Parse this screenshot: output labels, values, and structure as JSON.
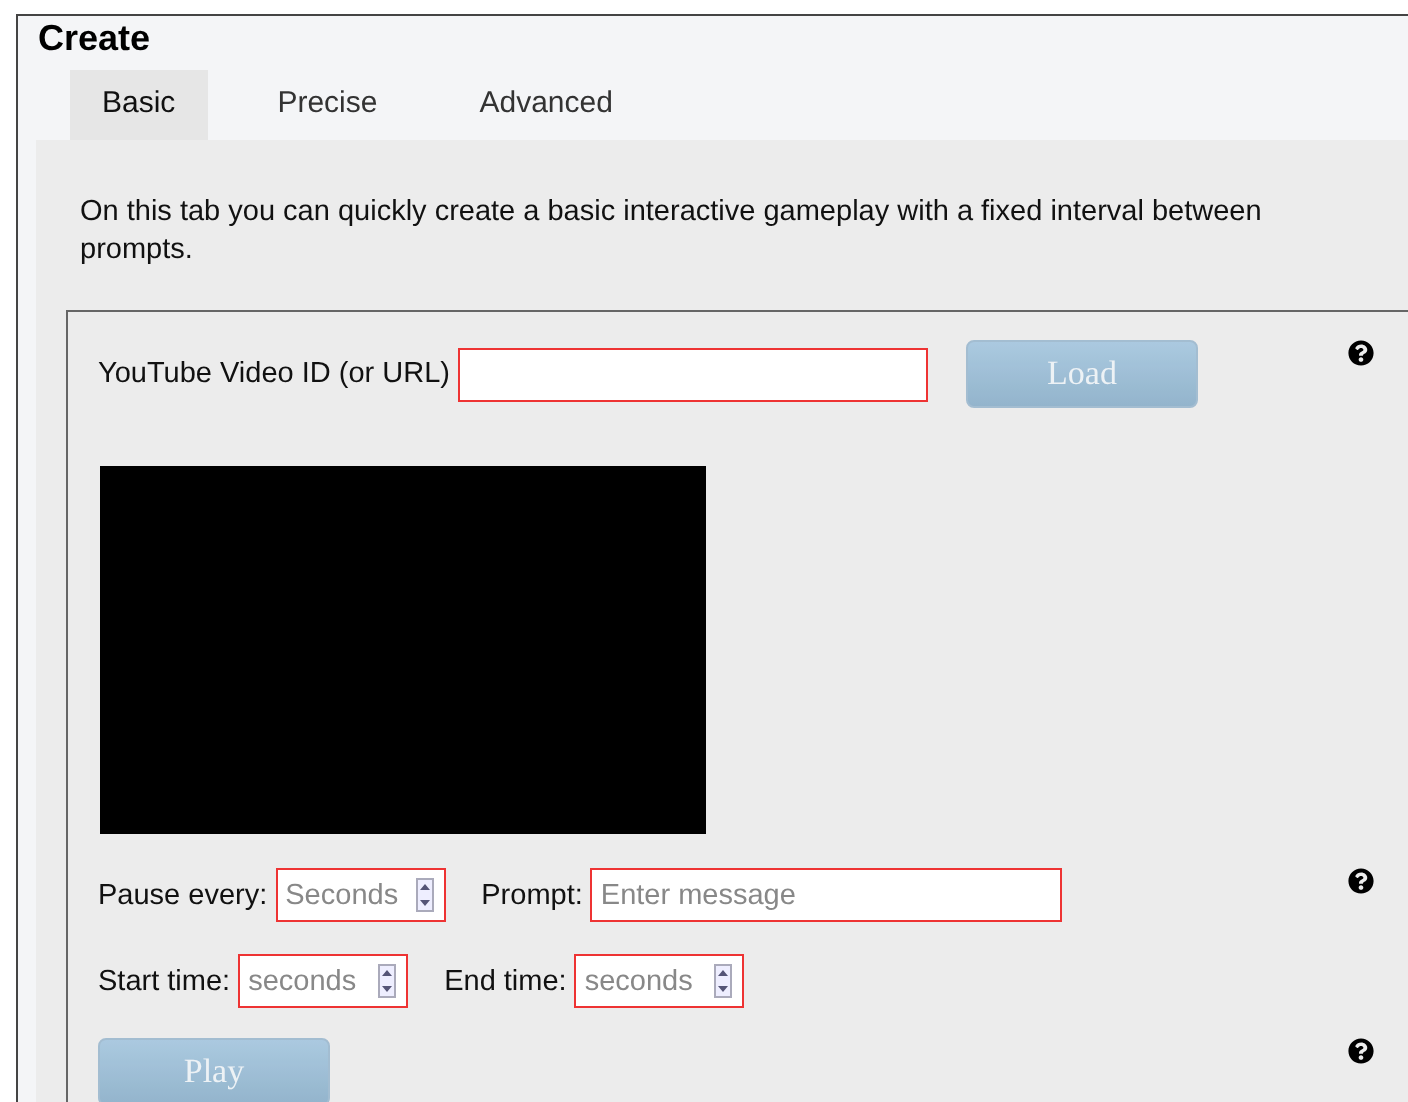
{
  "title": "Create",
  "tabs": [
    {
      "label": "Basic",
      "selected": true
    },
    {
      "label": "Precise",
      "selected": false
    },
    {
      "label": "Advanced",
      "selected": false
    }
  ],
  "description": "On this tab you can quickly create a basic interactive gameplay with a fixed interval between prompts.",
  "video_id": {
    "label": "YouTube Video ID (or URL)",
    "button": "Load",
    "disabled": true
  },
  "pause_row": [
    {
      "kind": "number",
      "label": "Pause every:",
      "placeholder": "Seconds"
    },
    {
      "kind": "text",
      "label": "Prompt:",
      "placeholder": "Enter message"
    }
  ],
  "time_row": [
    {
      "kind": "number",
      "label": "Start time:",
      "placeholder": "seconds"
    },
    {
      "kind": "number",
      "label": "End time:",
      "placeholder": "seconds"
    }
  ],
  "play": {
    "label": "Play",
    "disabled": true
  }
}
